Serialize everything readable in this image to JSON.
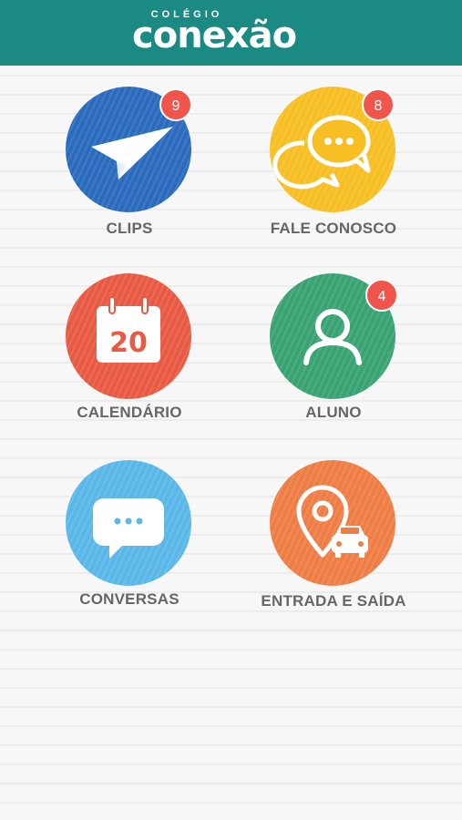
{
  "header": {
    "logo_small": "COLÉGIO",
    "logo_main": "conexão",
    "bg_color": "#1a8a83"
  },
  "menu": [
    {
      "label": "CLIPS",
      "icon": "paper-plane-icon",
      "color": "#2a6bbd",
      "badge": "9"
    },
    {
      "label": "FALE CONOSCO",
      "icon": "chat-bubbles-icon",
      "color": "#f7bf23",
      "badge": "8"
    },
    {
      "label": "CALENDÁRIO",
      "icon": "calendar-icon",
      "color": "#e85a43",
      "day": "20"
    },
    {
      "label": "ALUNO",
      "icon": "user-icon",
      "color": "#3aa373",
      "badge": "4"
    },
    {
      "label": "CONVERSAS",
      "icon": "speech-bubble-icon",
      "color": "#5ab8e8"
    },
    {
      "label": "ENTRADA E SAÍDA",
      "icon": "location-car-icon",
      "color": "#ee7e45"
    }
  ],
  "badge_color": "#f0554b"
}
